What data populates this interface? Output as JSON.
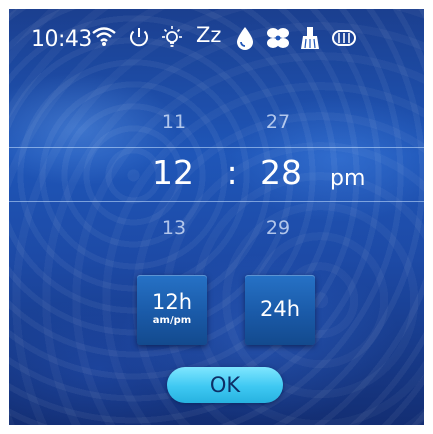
{
  "status_bar": {
    "time": "10:43",
    "icons": [
      "wifi-icon",
      "power-icon",
      "light-bulb-icon",
      "sleep-icon",
      "water-drop-icon",
      "fan-icon",
      "brush-icon",
      "side-brush-icon"
    ],
    "zz_label": "Zz"
  },
  "picker": {
    "hours": {
      "prev": "11",
      "current": "12",
      "next": "13"
    },
    "separator": ":",
    "minutes": {
      "prev": "27",
      "current": "28",
      "next": "29"
    },
    "ampm": "pm"
  },
  "mode_buttons": {
    "h12": {
      "label": "12h",
      "sublabel": "am/pm"
    },
    "h24": {
      "label": "24h"
    }
  },
  "ok_label": "OK",
  "colors": {
    "background": "#1f56b8",
    "ok_button": "#3ec8f2",
    "mode_button": "#1a5aa8",
    "text": "#ffffff"
  }
}
